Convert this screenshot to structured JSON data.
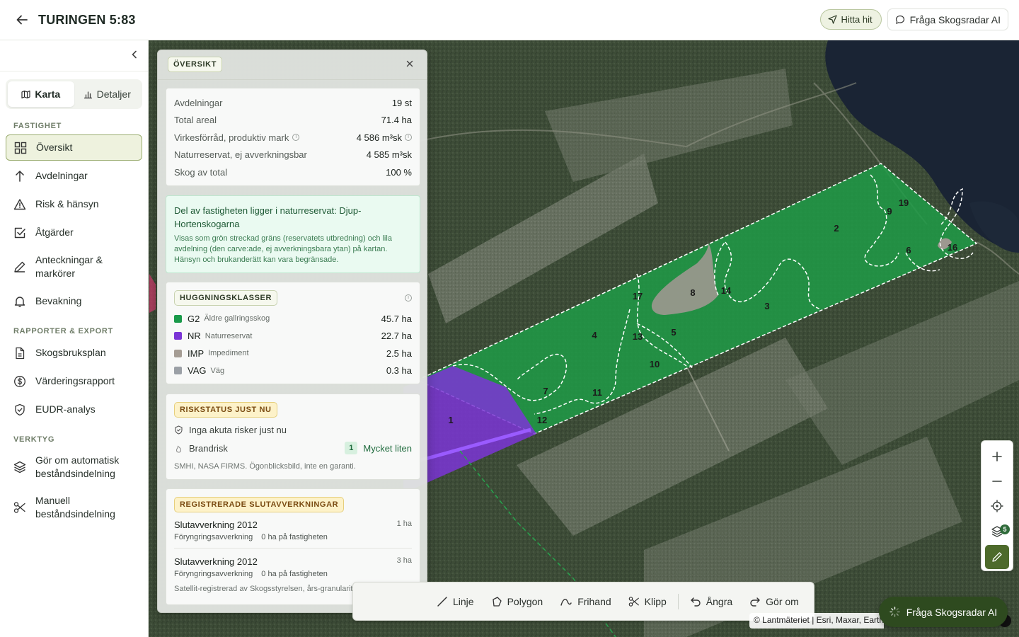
{
  "header": {
    "title": "TURINGEN 5:83",
    "find_label": "Hitta hit",
    "ask_label": "Fråga Skogsradar AI"
  },
  "sidebar": {
    "view_toggle": [
      {
        "label": "Karta",
        "icon": "map-icon",
        "active": true
      },
      {
        "label": "Detaljer",
        "icon": "bar-chart-icon",
        "active": false
      }
    ],
    "sections": [
      {
        "label": "FASTIGHET",
        "items": [
          {
            "label": "Översikt",
            "icon": "grid-icon",
            "active": true
          },
          {
            "label": "Avdelningar",
            "icon": "tree-icon"
          },
          {
            "label": "Risk & hänsyn",
            "icon": "warning-icon"
          },
          {
            "label": "Åtgärder",
            "icon": "checkbox-icon"
          },
          {
            "label": "Anteckningar & markörer",
            "icon": "pen-icon"
          },
          {
            "label": "Bevakning",
            "icon": "bell-icon"
          }
        ]
      },
      {
        "label": "RAPPORTER & EXPORT",
        "items": [
          {
            "label": "Skogsbruksplan",
            "icon": "document-icon"
          },
          {
            "label": "Värderingsrapport",
            "icon": "dollar-icon"
          },
          {
            "label": "EUDR-analys",
            "icon": "shield-check-icon"
          }
        ]
      },
      {
        "label": "VERKTYG",
        "items": [
          {
            "label": "Gör om automatisk beståndsindelning",
            "icon": "layers-icon"
          },
          {
            "label": "Manuell beståndsindelning",
            "icon": "scissors-icon"
          }
        ]
      }
    ]
  },
  "panel": {
    "title": "ÖVERSIKT",
    "stats": [
      {
        "key": "Avdelningar",
        "value": "19 st"
      },
      {
        "key": "Total areal",
        "value": "71.4 ha"
      },
      {
        "key": "Virkesförråd, produktiv mark",
        "value": "4 586 m³sk"
      },
      {
        "key": "Naturreservat, ej avverkningsbar",
        "value": "4 585 m³sk"
      },
      {
        "key": "Skog av total",
        "value": "100 %"
      }
    ],
    "reserve": {
      "title": "Del av fastigheten ligger i naturreservat: Djup-Hortenskogarna",
      "text": "Visas som grön streckad gräns (reservatets utbredning) och lila avdelning (den carve:ade, ej avverkningsbara ytan) på kartan. Hänsyn och brukanderätt kan vara begränsade."
    },
    "huggningsklasser": {
      "title": "HUGGNINGSKLASSER",
      "rows": [
        {
          "code": "G2",
          "name": "Äldre gallringsskog",
          "value": "45.7 ha",
          "color": "#1a9a4a"
        },
        {
          "code": "NR",
          "name": "Naturreservat",
          "value": "22.7 ha",
          "color": "#7b35d6"
        },
        {
          "code": "IMP",
          "name": "Impediment",
          "value": "2.5 ha",
          "color": "#a59d94"
        },
        {
          "code": "VAG",
          "name": "Väg",
          "value": "0.3 ha",
          "color": "#9ba0a6"
        }
      ]
    },
    "risk": {
      "title": "RISKSTATUS JUST NU",
      "ok_text": "Inga akuta risker just nu",
      "fire_label": "Brandrisk",
      "fire_level": "1",
      "fire_text": "Mycket liten",
      "source": "SMHI, NASA FIRMS. Ögonblicksbild, inte en garanti."
    },
    "clearcuts": {
      "title": "REGISTRERADE SLUTAVVERKNINGAR",
      "items": [
        {
          "title": "Slutavverkning 2012",
          "size": "1 ha",
          "type": "Föryngringsavverkning",
          "on_property": "0 ha på fastigheten"
        },
        {
          "title": "Slutavverkning 2012",
          "size": "3 ha",
          "type": "Föryngringsavverkning",
          "on_property": "0 ha på fastigheten"
        }
      ],
      "footer": "Satellit-registrerad av Skogsstyrelsen, års-granularitet"
    }
  },
  "map": {
    "stand_labels": [
      "1",
      "2",
      "3",
      "4",
      "5",
      "6",
      "7",
      "8",
      "9",
      "10",
      "11",
      "12",
      "13",
      "14",
      "16",
      "17",
      "19"
    ],
    "layers_count": "5",
    "attribution": "© Lantmäteriet | Esri, Maxar, Earth"
  },
  "drawbar": {
    "tools": [
      "Linje",
      "Polygon",
      "Frihand",
      "Klipp",
      "Ångra",
      "Gör om"
    ]
  },
  "ai_button": "Fråga Skogsradar AI"
}
